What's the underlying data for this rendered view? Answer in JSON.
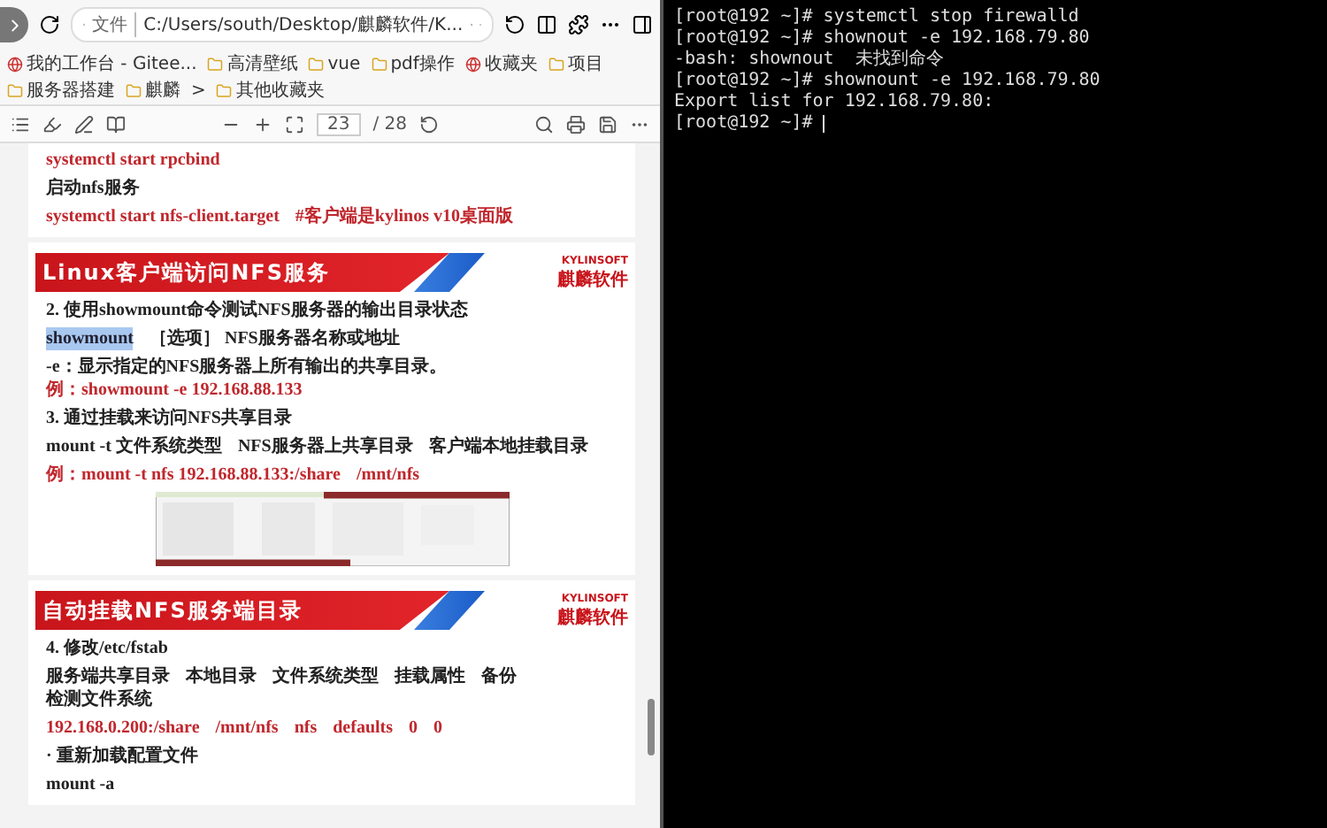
{
  "browser": {
    "address": {
      "scheme": "文件",
      "path": "C:/Users/south/Desktop/麒麟软件/K..."
    },
    "bookmarks": [
      {
        "label": "我的工作台 - Gitee...",
        "kind": "site"
      },
      {
        "label": "高清壁纸",
        "kind": "folder"
      },
      {
        "label": "vue",
        "kind": "folder"
      },
      {
        "label": "pdf操作",
        "kind": "folder"
      },
      {
        "label": "收藏夹",
        "kind": "site"
      },
      {
        "label": "项目",
        "kind": "folder"
      },
      {
        "label": "服务器搭建",
        "kind": "folder"
      },
      {
        "label": "麒麟",
        "kind": "folder"
      },
      {
        "label": ">",
        "kind": "more"
      },
      {
        "label": "其他收藏夹",
        "kind": "folder"
      }
    ],
    "pdf_toolbar": {
      "page": "23",
      "total": "/ 28"
    },
    "pages": [
      {
        "kind": "plain",
        "blocks": [
          {
            "kind": "line",
            "parts": [
              {
                "text": "systemctl  start rpcbind",
                "kind": "red"
              }
            ]
          },
          {
            "kind": "line",
            "parts": [
              {
                "text": "启动nfs服务",
                "kind": "plain"
              }
            ]
          },
          {
            "kind": "line",
            "parts": [
              {
                "text": "systemctl start nfs-client.target",
                "kind": "red"
              },
              {
                "text": "#客户端是kylinos v10桌面版",
                "kind": "red"
              }
            ]
          }
        ]
      },
      {
        "kind": "slide",
        "banner": "Linux客户端访问NFS服务",
        "logo": {
          "mark": "KYLINSOFT",
          "name": "麒麟软件"
        },
        "blocks": [
          {
            "kind": "line",
            "parts": [
              {
                "text": "2.   使用showmount命令测试NFS服务器的输出目录状态",
                "kind": "plain"
              }
            ]
          },
          {
            "kind": "line",
            "parts": [
              {
                "text": "showmount",
                "kind": "selected"
              },
              {
                "text": "［选项］ NFS服务器名称或地址",
                "kind": "plain"
              }
            ]
          },
          {
            "kind": "line",
            "parts": [
              {
                "text": "-e：显示指定的NFS服务器上所有输出的共享目录。",
                "kind": "plain"
              },
              {
                "text": "例：showmount  -e 192.168.88.133",
                "kind": "red"
              }
            ]
          },
          {
            "kind": "line",
            "parts": [
              {
                "text": "3.   通过挂载来访问NFS共享目录",
                "kind": "plain"
              }
            ]
          },
          {
            "kind": "line",
            "parts": [
              {
                "text": "mount  -t  文件系统类型",
                "kind": "plain"
              },
              {
                "text": "NFS服务器上共享目录",
                "kind": "plain"
              },
              {
                "text": "客户端本地挂载目录",
                "kind": "plain"
              }
            ]
          },
          {
            "kind": "line",
            "parts": [
              {
                "text": "例：mount   -t   nfs 192.168.88.133:/share",
                "kind": "red"
              },
              {
                "text": "/mnt/nfs",
                "kind": "red"
              }
            ]
          },
          {
            "kind": "picture"
          }
        ]
      },
      {
        "kind": "slide",
        "banner": "自动挂载NFS服务端目录",
        "logo": {
          "mark": "KYLINSOFT",
          "name": "麒麟软件"
        },
        "blocks": [
          {
            "kind": "line",
            "parts": [
              {
                "text": "4.   修改/etc/fstab",
                "kind": "plain"
              }
            ]
          },
          {
            "kind": "line",
            "parts": [
              {
                "text": "服务端共享目录",
                "kind": "plain"
              },
              {
                "text": "本地目录",
                "kind": "plain"
              },
              {
                "text": "文件系统类型",
                "kind": "plain"
              },
              {
                "text": "挂载属性",
                "kind": "plain"
              },
              {
                "text": "备份",
                "kind": "plain"
              },
              {
                "text": "检测文件系统",
                "kind": "plain"
              }
            ]
          },
          {
            "kind": "line",
            "parts": [
              {
                "text": "192.168.0.200:/share",
                "kind": "red"
              },
              {
                "text": "/mnt/nfs",
                "kind": "red"
              },
              {
                "text": "nfs",
                "kind": "red"
              },
              {
                "text": "defaults",
                "kind": "red"
              },
              {
                "text": "0",
                "kind": "red"
              },
              {
                "text": "0",
                "kind": "red"
              }
            ]
          },
          {
            "kind": "line",
            "parts": [
              {
                "text": "·  重新加载配置文件",
                "kind": "plain"
              }
            ]
          },
          {
            "kind": "line",
            "parts": [
              {
                "text": "mount  -a",
                "kind": "plain"
              }
            ]
          }
        ]
      }
    ]
  },
  "terminal": {
    "lines": [
      "[root@192 ~]# systemctl stop firewalld",
      "[root@192 ~]# shownout -e 192.168.79.80",
      "-bash: shownout  未找到命令",
      "[root@192 ~]# shownount -e 192.168.79.80",
      "Export list for 192.168.79.80:",
      "[root@192 ~]# "
    ],
    "cursor": true
  }
}
